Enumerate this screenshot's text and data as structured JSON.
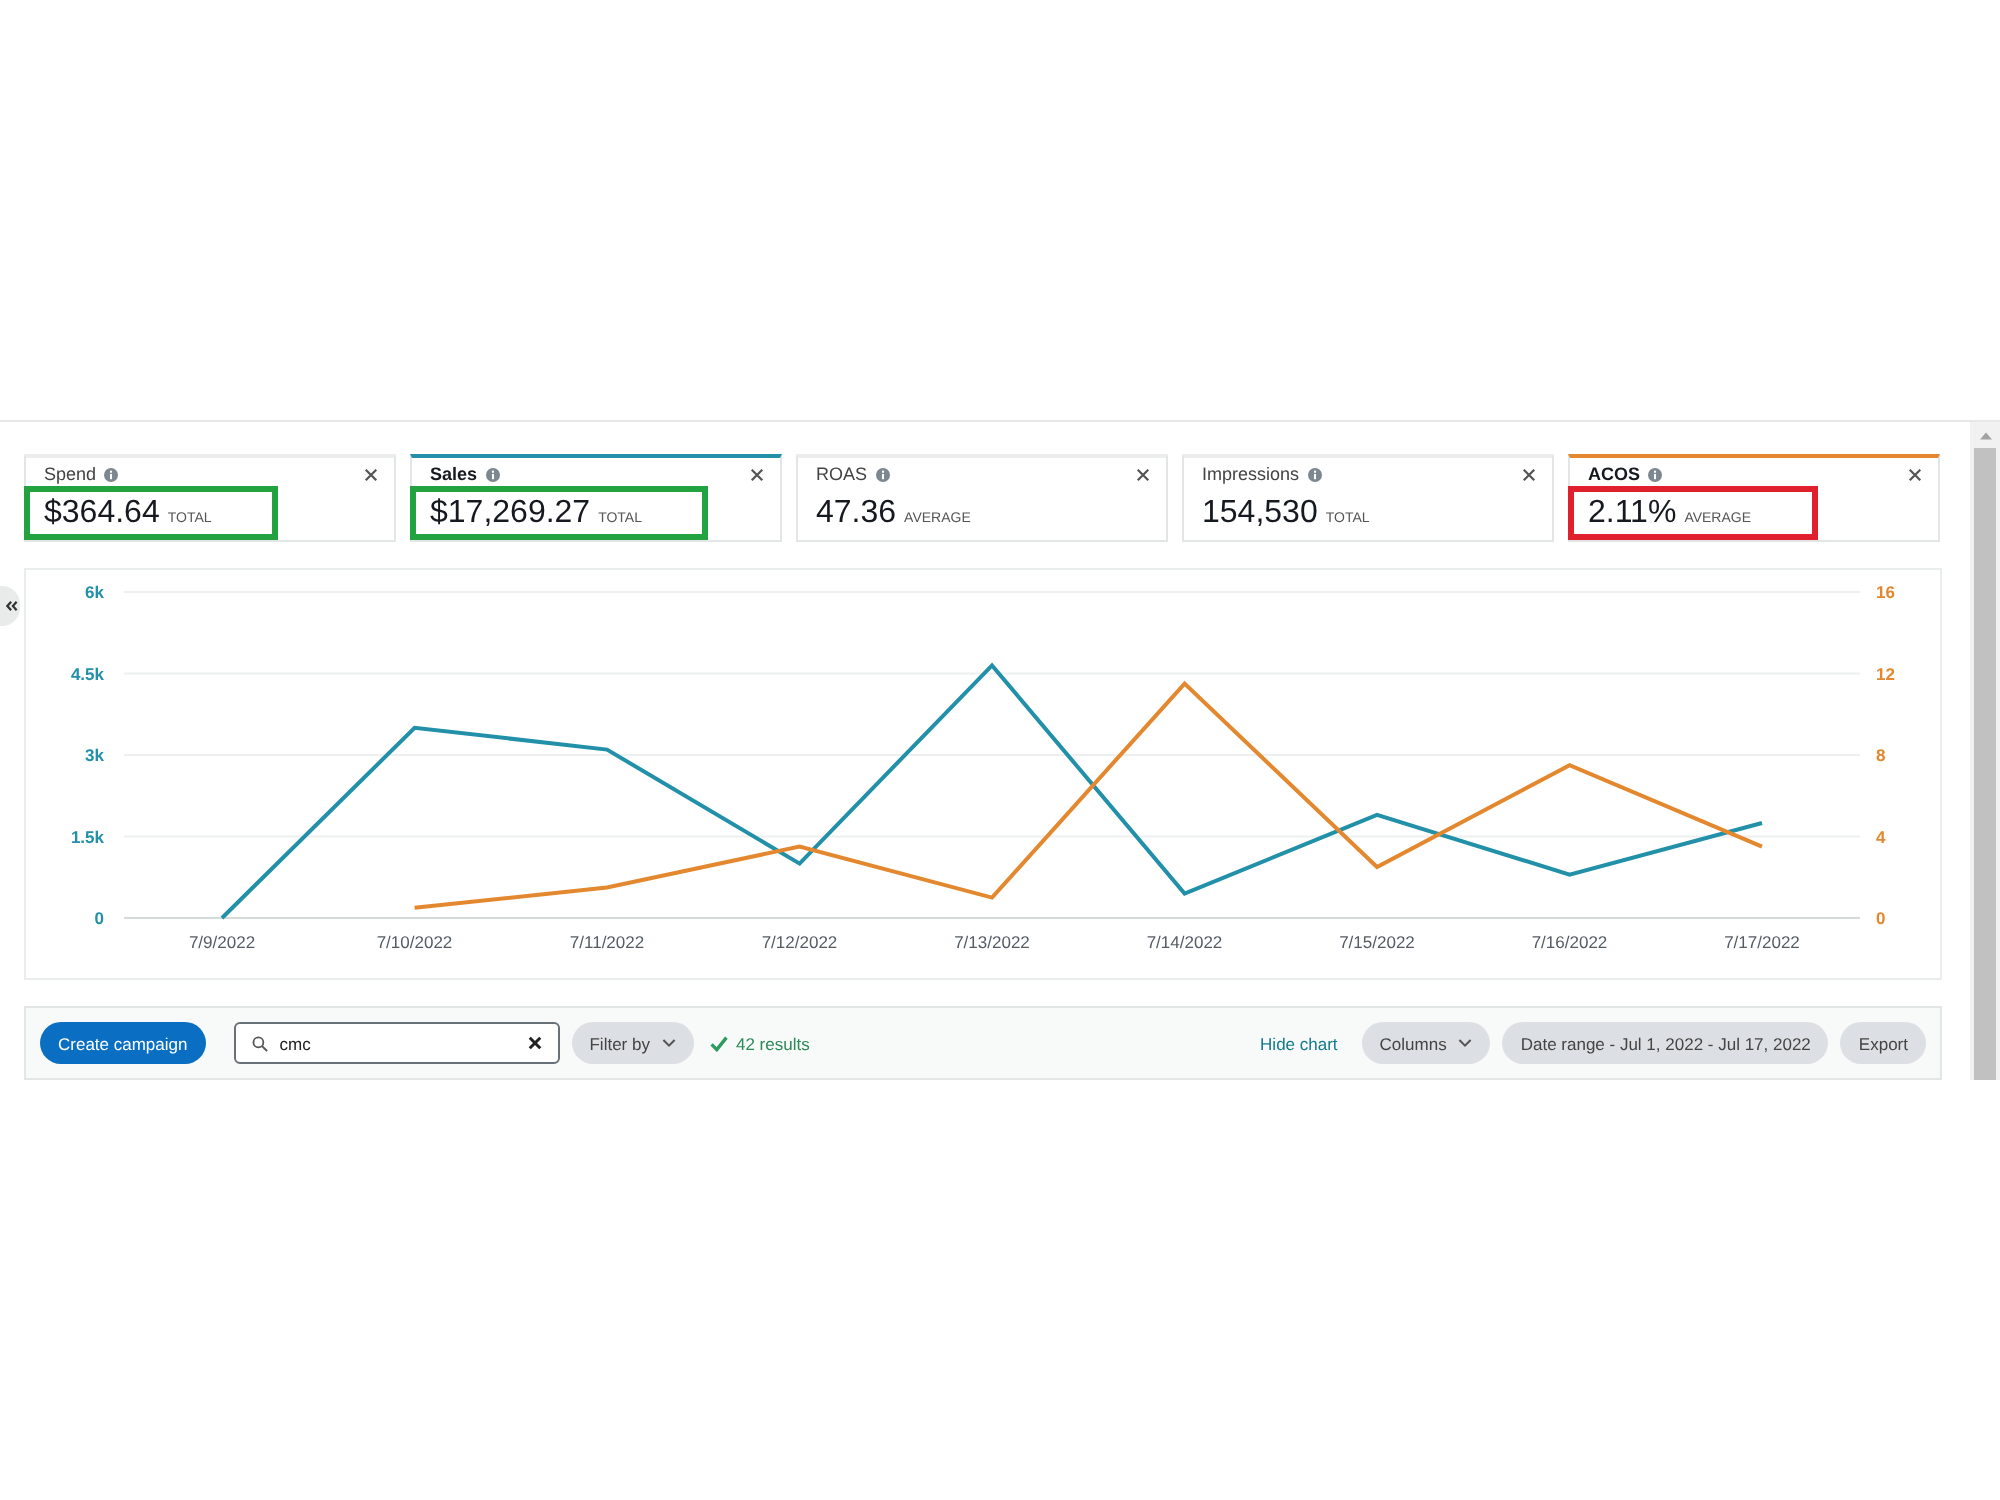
{
  "cards": [
    {
      "name": "Spend",
      "value": "$364.64",
      "unit": "TOTAL",
      "selected": false,
      "highlight": {
        "color": "#22a33f"
      }
    },
    {
      "name": "Sales",
      "value": "$17,269.27",
      "unit": "TOTAL",
      "selected": true,
      "color": "#2190a8",
      "highlight": {
        "color": "#22a33f"
      }
    },
    {
      "name": "ROAS",
      "value": "47.36",
      "unit": "AVERAGE",
      "selected": false
    },
    {
      "name": "Impressions",
      "value": "154,530",
      "unit": "TOTAL",
      "selected": false
    },
    {
      "name": "ACOS",
      "value": "2.11%",
      "unit": "AVERAGE",
      "selected": true,
      "color": "#e3882e",
      "highlight": {
        "color": "#e0202c"
      }
    }
  ],
  "chart": {
    "chart_data": {
      "type": "line",
      "categories": [
        "7/9/2022",
        "7/10/2022",
        "7/11/2022",
        "7/12/2022",
        "7/13/2022",
        "7/14/2022",
        "7/15/2022",
        "7/16/2022",
        "7/17/2022"
      ],
      "ylim": [
        0,
        6000
      ],
      "yticks": [
        {
          "value": 0,
          "label": "0"
        },
        {
          "value": 1500,
          "label": "1.5k"
        },
        {
          "value": 3000,
          "label": "3k"
        },
        {
          "value": 4500,
          "label": "4.5k"
        },
        {
          "value": 6000,
          "label": "6k"
        }
      ],
      "y2lim": [
        0,
        16
      ],
      "y2ticks": [
        0,
        4,
        8,
        12,
        16
      ],
      "grid": true,
      "series": [
        {
          "color": "#2190a8",
          "values": [
            0,
            3500,
            3100,
            1000,
            4650,
            450,
            1900,
            800,
            1750
          ]
        },
        {
          "color": "#e3882e",
          "axis": "y2",
          "values": [
            null,
            0.5,
            1.5,
            3.5,
            1,
            11.5,
            2.5,
            7.5,
            3.5
          ]
        }
      ]
    }
  },
  "toolbar": {
    "create_button": "Create campaign",
    "search": {
      "value": "cmc"
    },
    "filter_button": "Filter by",
    "results": "42 results",
    "hide_chart_link": "Hide chart",
    "columns_button": "Columns",
    "date_range_button": "Date range - Jul 1, 2022 - Jul 17, 2022",
    "export_button": "Export"
  }
}
